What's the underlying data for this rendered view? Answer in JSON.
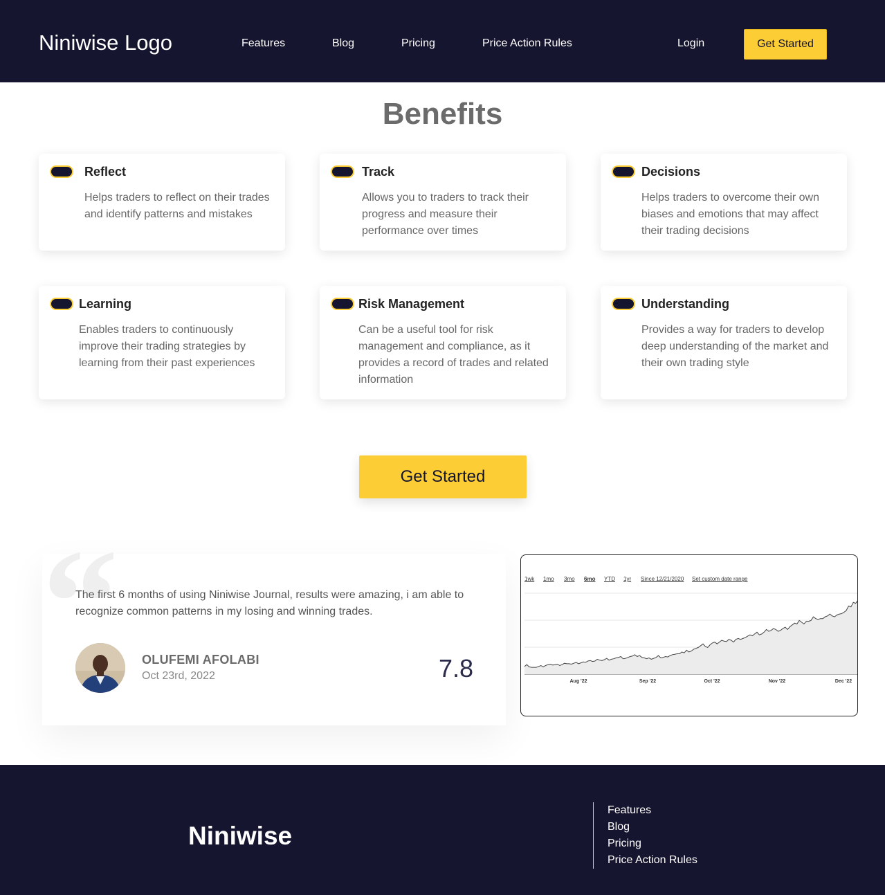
{
  "header": {
    "logo": "Niniwise Logo",
    "nav": [
      "Features",
      "Blog",
      "Pricing",
      "Price Action Rules"
    ],
    "login": "Login",
    "cta": "Get Started"
  },
  "benefits": {
    "title": "Benefits",
    "cards": [
      {
        "title": "Reflect",
        "text": "Helps traders to reflect on their trades and identify patterns and mistakes"
      },
      {
        "title": "Track",
        "text": "Allows you to traders to track their progress and measure their performance over times"
      },
      {
        "title": "Decisions",
        "text": "Helps traders to overcome their own biases and emotions that may affect their trading decisions"
      },
      {
        "title": "Learning",
        "text": "Enables traders to continuously improve their trading strategies by learning from their past experiences"
      },
      {
        "title": "Risk Management",
        "text": "Can be a useful tool for risk management and compliance, as it provides a record of trades and related information"
      },
      {
        "title": "Understanding",
        "text": "Provides a way for traders to develop deep understanding of the market and their own trading style"
      }
    ],
    "cta": "Get Started"
  },
  "testimonial": {
    "quote": "The first 6 months of using Niniwise Journal, results were amazing, i am able to recognize common patterns in my losing and winning trades.",
    "author": "OLUFEMI AFOLABI",
    "date": "Oct 23rd, 2022",
    "score": "7.8"
  },
  "chart_data": {
    "type": "area",
    "range_tabs": [
      "1wk",
      "1mo",
      "3mo",
      "6mo",
      "YTD",
      "1yr",
      "Since 12/21/2020",
      "Set custom date range"
    ],
    "active_range": "6mo",
    "x_tick_labels": [
      "Aug '22",
      "Sep '22",
      "Oct '22",
      "Nov '22",
      "Dec '22"
    ],
    "grid": true,
    "values": [
      8,
      12,
      7,
      6,
      6,
      6,
      8,
      10,
      7,
      10,
      12,
      13,
      11,
      12,
      13,
      10,
      12,
      15,
      14,
      14,
      13,
      15,
      17,
      14,
      16,
      18,
      17,
      20,
      21,
      19,
      20,
      24,
      22,
      21,
      23,
      26,
      22,
      24,
      25,
      27,
      28,
      30,
      25,
      26,
      28,
      30,
      31,
      34,
      30,
      32,
      28,
      27,
      25,
      27,
      24,
      26,
      28,
      32,
      27,
      28,
      30,
      29,
      32,
      34,
      35,
      36,
      36,
      40,
      38,
      44,
      40,
      42,
      46,
      48,
      50,
      54,
      58,
      52,
      50,
      56,
      60,
      62,
      58,
      62,
      66,
      64,
      63,
      68,
      66,
      62,
      68,
      70,
      68,
      70,
      72,
      75,
      78,
      76,
      80,
      84,
      78,
      80,
      84,
      90,
      86,
      88,
      92,
      90,
      86,
      88,
      92,
      95,
      90,
      96,
      100,
      104,
      102,
      110,
      106,
      102,
      108,
      108,
      110,
      118,
      114,
      112,
      114,
      114,
      118,
      120,
      124,
      120,
      118,
      122,
      124,
      125,
      128,
      132,
      142,
      140,
      150,
      148,
      155
    ]
  },
  "footer": {
    "brand": "Niniwise",
    "links": [
      "Features",
      "Blog",
      "Pricing",
      "Price Action Rules"
    ]
  },
  "colors": {
    "navy": "#15152f",
    "accent": "#fdcd36"
  }
}
